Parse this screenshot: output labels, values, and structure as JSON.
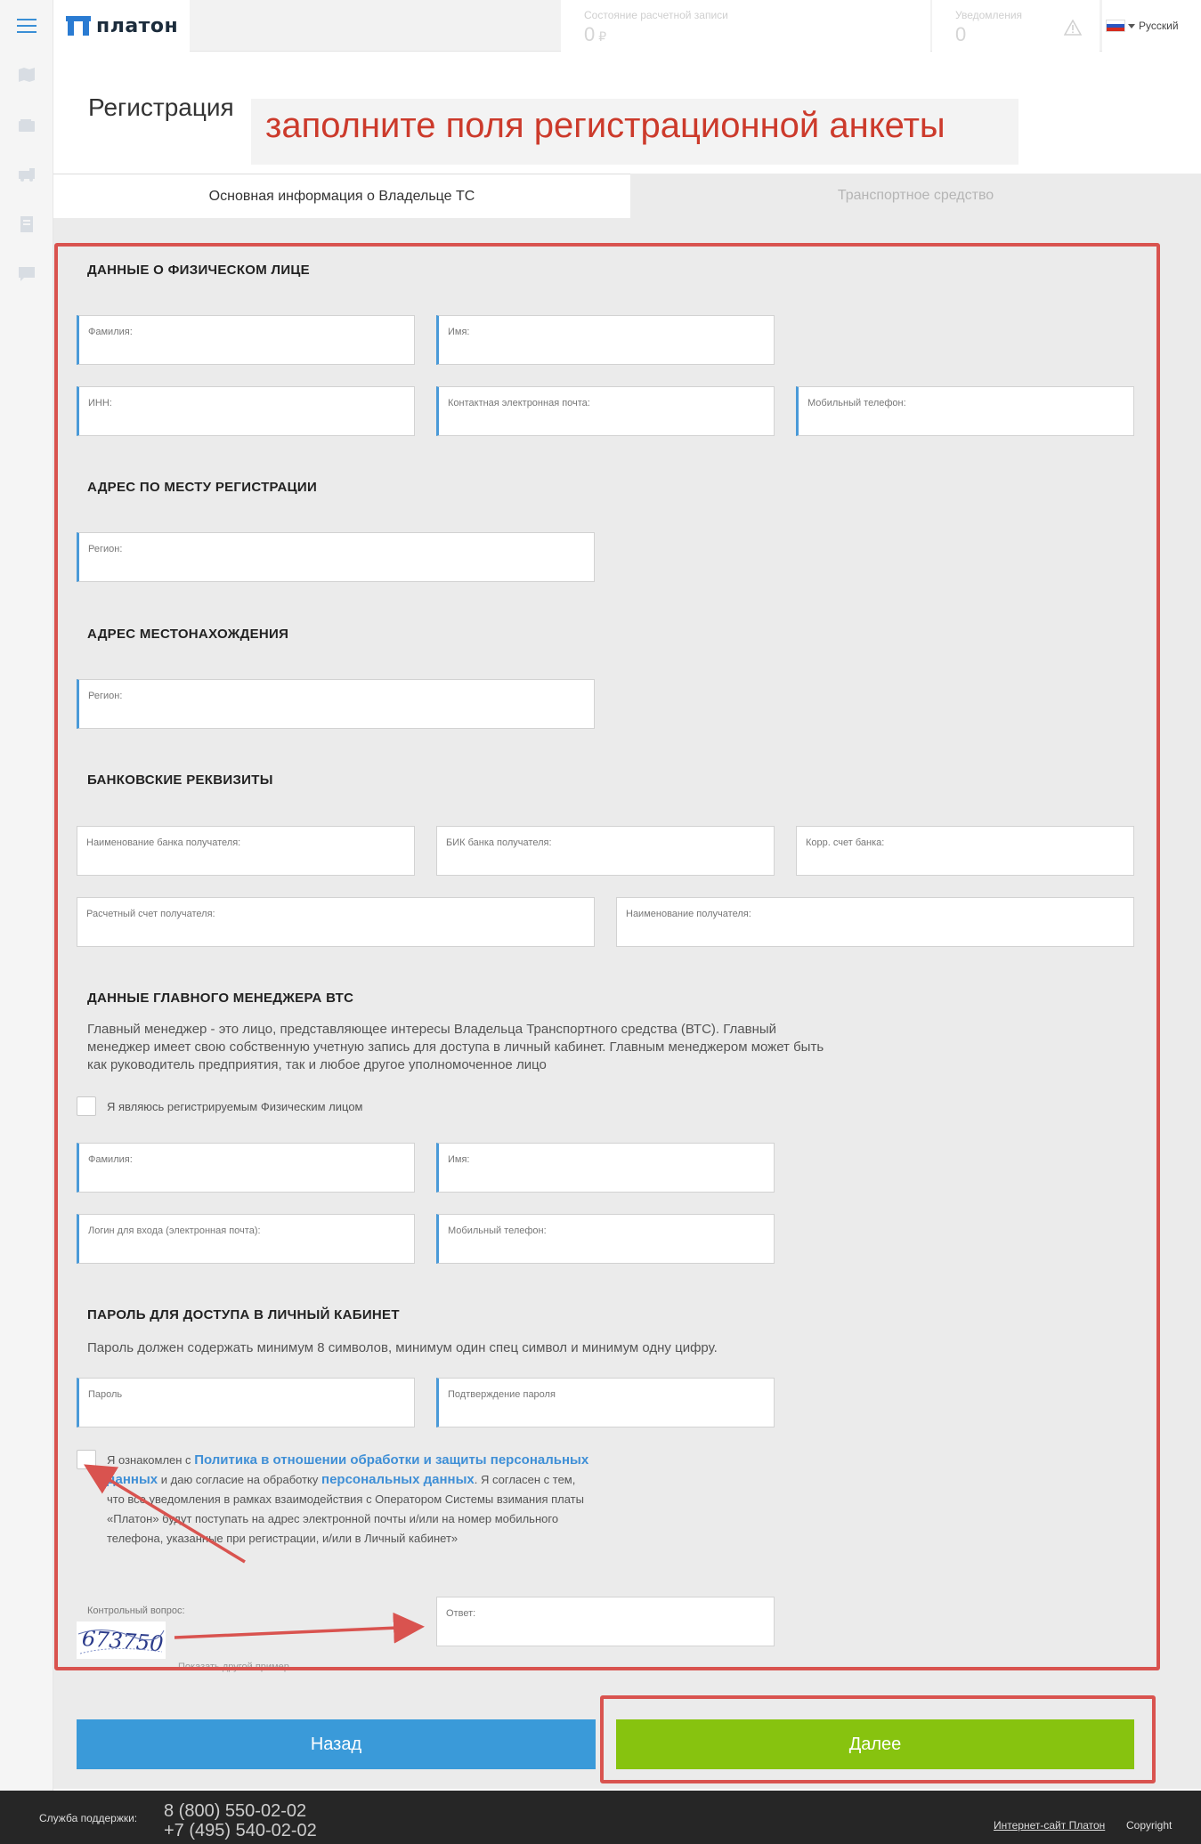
{
  "header": {
    "logo_text": "платон",
    "account_label": "Состояние расчетной записи",
    "account_value": "0",
    "account_currency": "₽",
    "notifications_label": "Уведомления",
    "notifications_value": "0",
    "language": "Русский"
  },
  "page": {
    "title": "Регистрация",
    "callout": "заполните поля регистрационной анкеты"
  },
  "tabs": [
    {
      "label": "Основная информация о Владельце ТС",
      "active": true
    },
    {
      "label": "Транспортное средство",
      "active": false
    }
  ],
  "sections": {
    "person": {
      "title": "ДАННЫЕ О ФИЗИЧЕСКОМ ЛИЦЕ",
      "last_name": "Фамилия:",
      "first_name": "Имя:",
      "inn": "ИНН:",
      "email": "Контактная электронная почта:",
      "phone": "Мобильный телефон:"
    },
    "reg_address": {
      "title": "АДРЕС ПО МЕСТУ РЕГИСТРАЦИИ",
      "region": "Регион:"
    },
    "location_address": {
      "title": "АДРЕС МЕСТОНАХОЖДЕНИЯ",
      "region": "Регион:"
    },
    "bank": {
      "title": "БАНКОВСКИЕ РЕКВИЗИТЫ",
      "bank_name": "Наименование банка получателя:",
      "bik": "БИК банка получателя:",
      "corr": "Корр. счет банка:",
      "account": "Расчетный счет получателя:",
      "recipient": "Наименование получателя:"
    },
    "manager": {
      "title": "ДАННЫЕ ГЛАВНОГО МЕНЕДЖЕРА ВТС",
      "desc1": "Главный менеджер - это лицо, представляющее интересы Владельца Транспортного средства (ВТС). Главный",
      "desc2": "менеджер имеет свою собственную учетную запись для доступа в личный кабинет. Главным менеджером может быть",
      "desc3": "как руководитель предприятия, так и любое другое уполномоченное лицо",
      "self_checkbox": "Я являюсь регистрируемым Физическим лицом",
      "last_name": "Фамилия:",
      "first_name": "Имя:",
      "login": "Логин для входа (электронная почта):",
      "phone": "Мобильный телефон:"
    },
    "password": {
      "title": "ПАРОЛЬ ДЛЯ ДОСТУПА В ЛИЧНЫЙ КАБИНЕТ",
      "hint": "Пароль должен содержать минимум 8 символов, минимум один спец символ и минимум одну цифру.",
      "password": "Пароль",
      "confirm": "Подтверждение пароля"
    },
    "consent": {
      "t1": "Я ознакомлен с ",
      "link1": "Политика в отношении обработки и защиты персональных данных",
      "t2": " и даю согласие на обработку ",
      "link2": "персональных данных",
      "t3": ". Я согласен с тем, что все уведомления в рамках взаимодействия с Оператором Системы взимания платы «Платон» будут поступать на адрес электронной почты и/или на номер мобильного телефона, указанные при регистрации, и/или в Личный кабинет»"
    },
    "captcha": {
      "question": "Контрольный вопрос:",
      "code": "673750",
      "answer": "Ответ:",
      "refresh": "Показать другой пример"
    }
  },
  "buttons": {
    "back": "Назад",
    "next": "Далее"
  },
  "footer": {
    "support_label": "Служба поддержки:",
    "phone1": "8 (800) 550-02-02",
    "phone2": "+7 (495) 540-02-02",
    "site": "Интернет-сайт Платон",
    "copyright": "Copyright"
  },
  "colors": {
    "accent_blue": "#3a9ad9",
    "next_green": "#87c30f",
    "annotation_red": "#d9534f"
  }
}
